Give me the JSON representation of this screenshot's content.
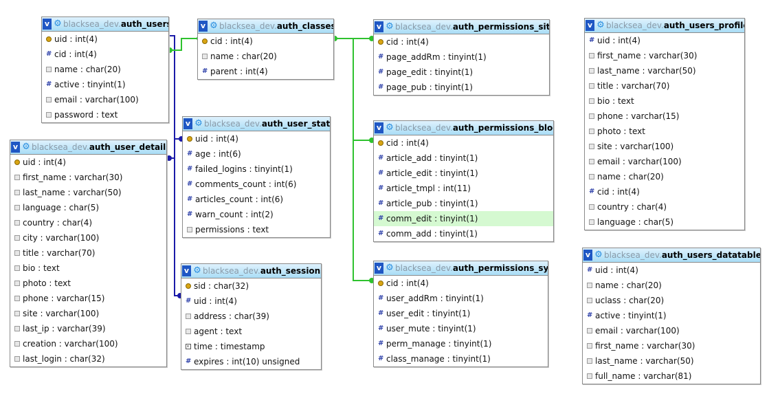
{
  "diagram": {
    "tables": [
      {
        "id": "auth_users",
        "database": "blacksea_dev.",
        "name": "auth_users",
        "columns": [
          {
            "text": "uid : int(4)",
            "icon": "key"
          },
          {
            "text": "cid : int(4)",
            "icon": "numeric"
          },
          {
            "text": "name : char(20)",
            "icon": "text"
          },
          {
            "text": "active : tinyint(1)",
            "icon": "numeric"
          },
          {
            "text": "email : varchar(100)",
            "icon": "text"
          },
          {
            "text": "password : text",
            "icon": "text"
          }
        ]
      },
      {
        "id": "auth_classes",
        "database": "blacksea_dev.",
        "name": "auth_classes",
        "columns": [
          {
            "text": "cid : int(4)",
            "icon": "key"
          },
          {
            "text": "name : char(20)",
            "icon": "text"
          },
          {
            "text": "parent : int(4)",
            "icon": "numeric"
          }
        ]
      },
      {
        "id": "auth_permissions_site",
        "database": "blacksea_dev.",
        "name": "auth_permissions_site",
        "columns": [
          {
            "text": "cid : int(4)",
            "icon": "key"
          },
          {
            "text": "page_addRm : tinyint(1)",
            "icon": "numeric"
          },
          {
            "text": "page_edit : tinyint(1)",
            "icon": "numeric"
          },
          {
            "text": "page_pub : tinyint(1)",
            "icon": "numeric"
          }
        ]
      },
      {
        "id": "auth_users_profile",
        "database": "blacksea_dev.",
        "name": "auth_users_profile",
        "columns": [
          {
            "text": "uid : int(4)",
            "icon": "numeric"
          },
          {
            "text": "first_name : varchar(30)",
            "icon": "text"
          },
          {
            "text": "last_name : varchar(50)",
            "icon": "text"
          },
          {
            "text": "title : varchar(70)",
            "icon": "text"
          },
          {
            "text": "bio : text",
            "icon": "text"
          },
          {
            "text": "phone : varchar(15)",
            "icon": "text"
          },
          {
            "text": "photo : text",
            "icon": "text"
          },
          {
            "text": "site : varchar(100)",
            "icon": "text"
          },
          {
            "text": "email : varchar(100)",
            "icon": "text"
          },
          {
            "text": "name : char(20)",
            "icon": "text"
          },
          {
            "text": "cid : int(4)",
            "icon": "numeric"
          },
          {
            "text": "country : char(4)",
            "icon": "text"
          },
          {
            "text": "language : char(5)",
            "icon": "text"
          }
        ]
      },
      {
        "id": "auth_user_stats",
        "database": "blacksea_dev.",
        "name": "auth_user_stats",
        "columns": [
          {
            "text": "uid : int(4)",
            "icon": "key"
          },
          {
            "text": "age : int(6)",
            "icon": "numeric"
          },
          {
            "text": "failed_logins : tinyint(1)",
            "icon": "numeric"
          },
          {
            "text": "comments_count : int(6)",
            "icon": "numeric"
          },
          {
            "text": "articles_count : int(6)",
            "icon": "numeric"
          },
          {
            "text": "warn_count : int(2)",
            "icon": "numeric"
          },
          {
            "text": "permissions : text",
            "icon": "text"
          }
        ]
      },
      {
        "id": "auth_permissions_blog",
        "database": "blacksea_dev.",
        "name": "auth_permissions_blog",
        "columns": [
          {
            "text": "cid : int(4)",
            "icon": "key"
          },
          {
            "text": "article_add : tinyint(1)",
            "icon": "numeric"
          },
          {
            "text": "article_edit : tinyint(1)",
            "icon": "numeric"
          },
          {
            "text": "article_tmpl : int(11)",
            "icon": "numeric"
          },
          {
            "text": "article_pub : tinyint(1)",
            "icon": "numeric"
          },
          {
            "text": "comm_edit : tinyint(1)",
            "icon": "numeric",
            "highlighted": true
          },
          {
            "text": "comm_add : tinyint(1)",
            "icon": "numeric"
          }
        ]
      },
      {
        "id": "auth_user_details",
        "database": "blacksea_dev.",
        "name": "auth_user_details",
        "columns": [
          {
            "text": "uid : int(4)",
            "icon": "key"
          },
          {
            "text": "first_name : varchar(30)",
            "icon": "text"
          },
          {
            "text": "last_name : varchar(50)",
            "icon": "text"
          },
          {
            "text": "language : char(5)",
            "icon": "text"
          },
          {
            "text": "country : char(4)",
            "icon": "text"
          },
          {
            "text": "city : varchar(100)",
            "icon": "text"
          },
          {
            "text": "title : varchar(70)",
            "icon": "text"
          },
          {
            "text": "bio : text",
            "icon": "text"
          },
          {
            "text": "photo : text",
            "icon": "text"
          },
          {
            "text": "phone : varchar(15)",
            "icon": "text"
          },
          {
            "text": "site : varchar(100)",
            "icon": "text"
          },
          {
            "text": "last_ip : varchar(39)",
            "icon": "text"
          },
          {
            "text": "creation : varchar(100)",
            "icon": "text"
          },
          {
            "text": "last_login : char(32)",
            "icon": "text"
          }
        ]
      },
      {
        "id": "auth_sessions",
        "database": "blacksea_dev.",
        "name": "auth_sessions",
        "columns": [
          {
            "text": "sid : char(32)",
            "icon": "key"
          },
          {
            "text": "uid : int(4)",
            "icon": "numeric"
          },
          {
            "text": "address : char(39)",
            "icon": "text"
          },
          {
            "text": "agent : text",
            "icon": "text"
          },
          {
            "text": "time : timestamp",
            "icon": "timestamp"
          },
          {
            "text": "expires : int(10) unsigned",
            "icon": "numeric"
          }
        ]
      },
      {
        "id": "auth_permissions_sys",
        "database": "blacksea_dev.",
        "name": "auth_permissions_sys",
        "columns": [
          {
            "text": "cid : int(4)",
            "icon": "key"
          },
          {
            "text": "user_addRm : tinyint(1)",
            "icon": "numeric"
          },
          {
            "text": "user_edit : tinyint(1)",
            "icon": "numeric"
          },
          {
            "text": "user_mute : tinyint(1)",
            "icon": "numeric"
          },
          {
            "text": "perm_manage : tinyint(1)",
            "icon": "numeric"
          },
          {
            "text": "class_manage : tinyint(1)",
            "icon": "numeric"
          }
        ]
      },
      {
        "id": "auth_users_datatables",
        "database": "blacksea_dev.",
        "name": "auth_users_datatables",
        "columns": [
          {
            "text": "uid : int(4)",
            "icon": "numeric"
          },
          {
            "text": "name : char(20)",
            "icon": "text"
          },
          {
            "text": "uclass : char(20)",
            "icon": "text"
          },
          {
            "text": "active : tinyint(1)",
            "icon": "numeric"
          },
          {
            "text": "email : varchar(100)",
            "icon": "text"
          },
          {
            "text": "first_name : varchar(30)",
            "icon": "text"
          },
          {
            "text": "last_name : varchar(50)",
            "icon": "text"
          },
          {
            "text": "full_name : varchar(81)",
            "icon": "text"
          }
        ]
      }
    ],
    "toggle_glyph": "v",
    "colors": {
      "relation_uid": "#1a1aa8",
      "relation_cid": "#2ec22e",
      "header_top": "#dff2fd",
      "header_bottom": "#a9ddf6",
      "highlight_row": "#d5f9d1"
    }
  }
}
